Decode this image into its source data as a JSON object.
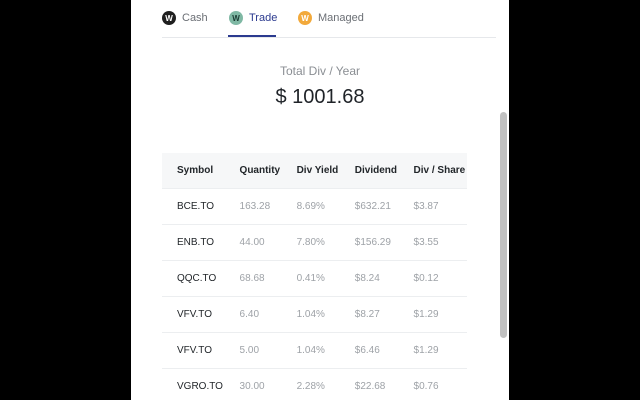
{
  "tabs": [
    {
      "label": "Cash",
      "icon": "wealthsimple-logo-icon"
    },
    {
      "label": "Trade",
      "icon": "wealthsimple-logo-icon"
    },
    {
      "label": "Managed",
      "icon": "wealthsimple-logo-icon"
    }
  ],
  "active_tab": "Trade",
  "summary": {
    "label": "Total Div / Year",
    "value": "$ 1001.68"
  },
  "table": {
    "columns": [
      "Symbol",
      "Quantity",
      "Div Yield",
      "Dividend",
      "Div / Share"
    ],
    "rows": [
      {
        "symbol": "BCE.TO",
        "quantity": "163.28",
        "yield": "8.69%",
        "dividend": "$632.21",
        "per_share": "$3.87"
      },
      {
        "symbol": "ENB.TO",
        "quantity": "44.00",
        "yield": "7.80%",
        "dividend": "$156.29",
        "per_share": "$3.55"
      },
      {
        "symbol": "QQC.TO",
        "quantity": "68.68",
        "yield": "0.41%",
        "dividend": "$8.24",
        "per_share": "$0.12"
      },
      {
        "symbol": "VFV.TO",
        "quantity": "6.40",
        "yield": "1.04%",
        "dividend": "$8.27",
        "per_share": "$1.29"
      },
      {
        "symbol": "VFV.TO",
        "quantity": "5.00",
        "yield": "1.04%",
        "dividend": "$6.46",
        "per_share": "$1.29"
      },
      {
        "symbol": "VGRO.TO",
        "quantity": "30.00",
        "yield": "2.28%",
        "dividend": "$22.68",
        "per_share": "$0.76"
      }
    ]
  },
  "colors": {
    "accent": "#2b3a8f",
    "trade_icon": "#7fb8a4",
    "managed_icon": "#f2a93b",
    "cash_icon": "#1f1f1f"
  }
}
